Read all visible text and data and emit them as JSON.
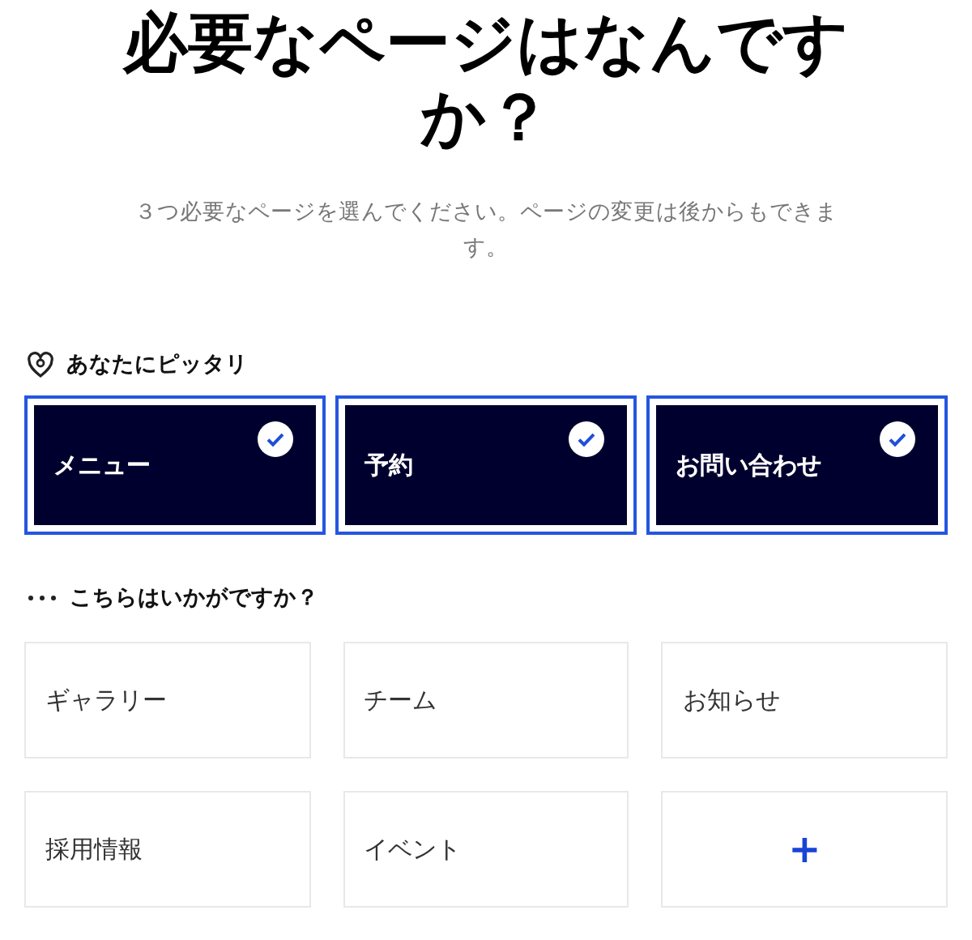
{
  "title": "必要なページはなんですか？",
  "subtitle": "３つ必要なページを選んでください。ページの変更は後からもできます。",
  "recommended": {
    "heading": "あなたにピッタリ",
    "items": [
      {
        "label": "メニュー",
        "selected": true
      },
      {
        "label": "予約",
        "selected": true
      },
      {
        "label": "お問い合わせ",
        "selected": true
      }
    ]
  },
  "suggestions": {
    "heading": "こちらはいかがですか？",
    "items": [
      {
        "kind": "page",
        "label": "ギャラリー",
        "selected": false
      },
      {
        "kind": "page",
        "label": "チーム",
        "selected": false
      },
      {
        "kind": "page",
        "label": "お知らせ",
        "selected": false
      },
      {
        "kind": "page",
        "label": "採用情報",
        "selected": false
      },
      {
        "kind": "page",
        "label": "イベント",
        "selected": false
      },
      {
        "kind": "add",
        "label": "+",
        "selected": false
      }
    ]
  }
}
